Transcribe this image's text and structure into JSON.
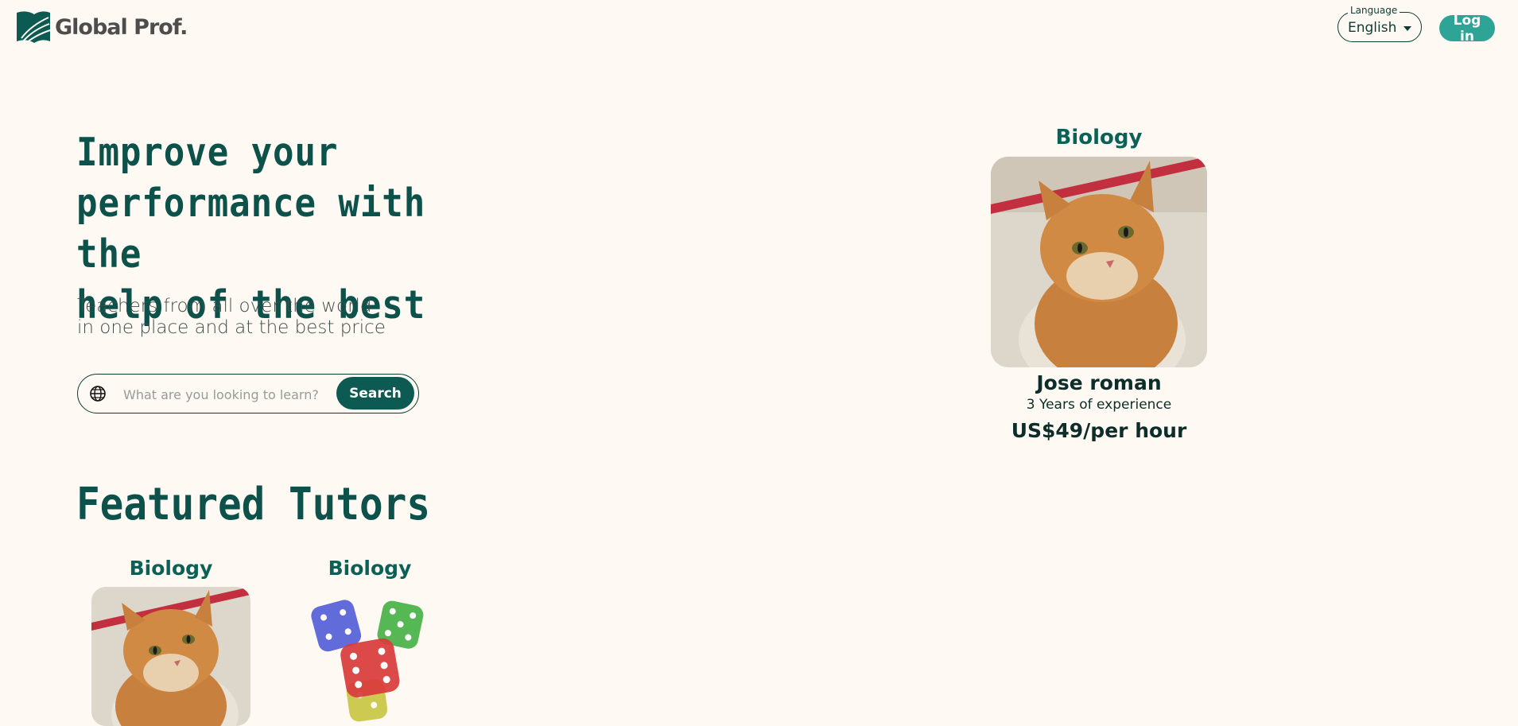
{
  "brand": {
    "name": "Global Prof."
  },
  "header": {
    "language_label": "Language",
    "language_value": "English",
    "login_label": "Log in"
  },
  "hero": {
    "title_line1": "Improve your",
    "title_line2": "performance with the",
    "title_line3": "help of the best",
    "subtitle_line1": "Teachers from all over the world",
    "subtitle_line2": "in one place and at the best price"
  },
  "search": {
    "placeholder": "What are you looking to learn?",
    "button_label": "Search"
  },
  "featured_tutor": {
    "subject": "Biology",
    "name": "Jose roman",
    "experience": "3 Years of experience",
    "price": "US$49/per hour"
  },
  "featured_section": {
    "title": "Featured Tutors",
    "cards": [
      {
        "subject": "Biology"
      },
      {
        "subject": "Biology"
      }
    ]
  },
  "colors": {
    "background": "#fefaf3",
    "brand_dark": "#0c524b",
    "accent": "#2da495",
    "button_dark": "#0c5a52"
  }
}
